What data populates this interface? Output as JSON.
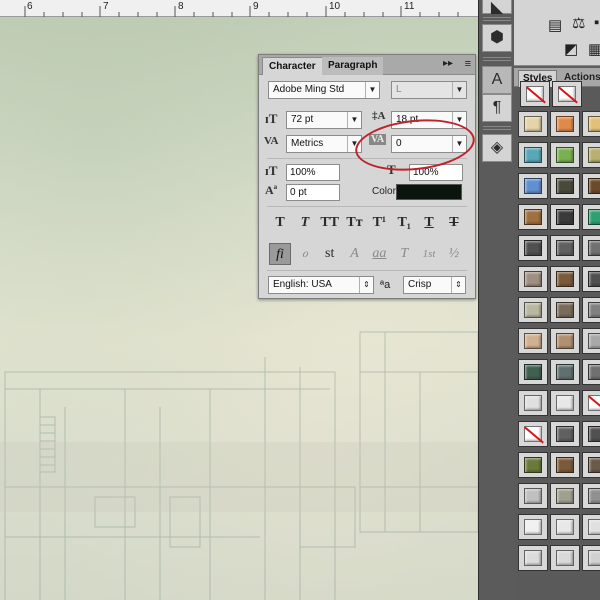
{
  "ruler": {
    "marks": [
      "6",
      "7",
      "8",
      "9",
      "10",
      "11"
    ]
  },
  "character_panel": {
    "tabs": [
      "Character",
      "Paragraph"
    ],
    "collapse_glyph": "▸▸",
    "menu_glyph": "≡",
    "font_family": "Adobe Ming Std",
    "font_style": "L",
    "font_size": "72 pt",
    "leading": "18 pt",
    "kerning": "Metrics",
    "tracking": "0",
    "vertical_scale": "100%",
    "horizontal_scale": "100%",
    "baseline_shift": "0 pt",
    "color_label": "Color:",
    "color_value": "#0a150e",
    "type_styles": [
      {
        "name": "faux-bold-button",
        "glyph": "T"
      },
      {
        "name": "faux-italic-button",
        "glyph": "T"
      },
      {
        "name": "all-caps-button",
        "glyph": "TT"
      },
      {
        "name": "small-caps-button",
        "glyph": "Tт"
      },
      {
        "name": "superscript-button",
        "glyph": "T¹"
      },
      {
        "name": "subscript-button",
        "glyph": "T₁"
      },
      {
        "name": "underline-button",
        "glyph": "T"
      },
      {
        "name": "strikethrough-button",
        "glyph": "T"
      }
    ],
    "opentype_features": [
      {
        "name": "standard-ligatures-button",
        "glyph": "fi"
      },
      {
        "name": "contextual-alternates-button",
        "glyph": "ℴ"
      },
      {
        "name": "discretionary-ligatures-button",
        "glyph": "st"
      },
      {
        "name": "swash-button",
        "glyph": "A"
      },
      {
        "name": "stylistic-alternates-button",
        "glyph": "aa"
      },
      {
        "name": "titling-alternates-button",
        "glyph": "T"
      },
      {
        "name": "ordinals-button",
        "glyph": "1st"
      },
      {
        "name": "fractions-button",
        "glyph": "½"
      }
    ],
    "language": "English: USA",
    "anti_alias_label": "ªa",
    "anti_alias": "Crisp"
  },
  "styles_panel": {
    "tabs": [
      "Styles",
      "Actions"
    ],
    "swatches": [
      "none",
      "none",
      "#e4d4a8",
      "#e08a4a",
      "#e2c07a",
      "#58a8b8",
      "#7ab050",
      "#b8b070",
      "#6090d0",
      "#4a4a3a",
      "#6a4a2a",
      "#a07040",
      "#3a3a3a",
      "#30a070",
      "#505050",
      "#606060",
      "#707070",
      "#a09080",
      "#7a5a3a",
      "#505050",
      "#b8b8a0",
      "#7a6a5a",
      "#808080",
      "#d0b090",
      "#b09070",
      "#a8a8a8",
      "#406050",
      "#607070",
      "#707070",
      "#e0e0e0",
      "#e8e8e8",
      "none",
      "none",
      "#606060",
      "#505050",
      "#6a7a3a",
      "#7a5a3a",
      "#6a5a4a",
      "#c0c0c0",
      "#a0a090",
      "#909090",
      "#f0f0f0",
      "#e8e8e8",
      "#e0e0e0",
      "#dcdcdc",
      "#d8d8d8",
      "#d0d0d0"
    ]
  }
}
